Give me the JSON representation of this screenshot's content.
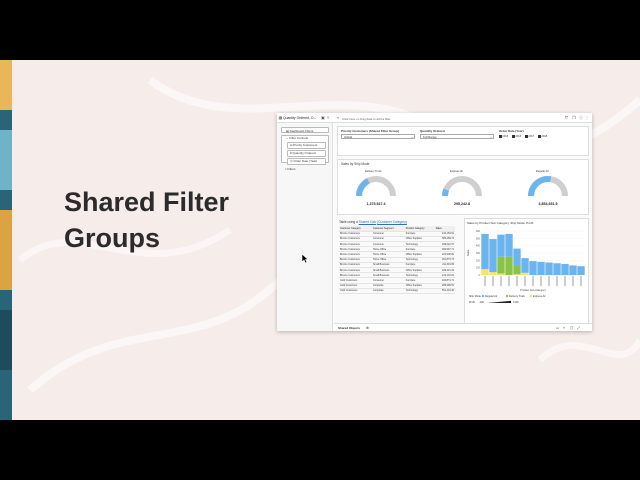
{
  "slide": {
    "headline_line1": "Shared Filter",
    "headline_line2": "Groups"
  },
  "app": {
    "title": "Quantity Ordered, O...",
    "filter_hint": "Click here or drag data to add a filter",
    "sidebar": {
      "dashboard_filters": "Dashboard Filters",
      "filter_controls": "Filter Controls",
      "items": [
        "Priority Customers",
        "Quantity Ordered",
        "Order Date (Year)"
      ],
      "filters": "Filters"
    },
    "filter_bar": {
      "priority_label": "Priority Customers (Shared Filter Group)",
      "priority_value": "Global",
      "quantity_label": "Quantity Ordered",
      "quantity_value": "Full Range",
      "year_label": "Order Date (Year)",
      "years": [
        "2015",
        "2016",
        "2017",
        "2018"
      ]
    },
    "gauges": {
      "title": "Sales by Ship Mode",
      "items": [
        {
          "label": "Delivery Truck",
          "value": "1,375,927.4",
          "fill": 0.35
        },
        {
          "label": "Express Air",
          "value": "295,242.8",
          "fill": 0.12
        },
        {
          "label": "Regular Air",
          "value": "3,854,651.9",
          "fill": 0.55
        }
      ],
      "colors": {
        "fill": "#6cb4ee",
        "track": "#cfcfcf"
      }
    },
    "table": {
      "title_prefix": "Table using a ",
      "title_link1": "Shared Calc",
      "title_mid": " ",
      "title_link2": "(Customer Category)",
      "headers": [
        "Customer Category",
        "Customer Segment",
        "Product Category",
        "Sales"
      ],
      "rows": [
        [
          "Bronze Customers",
          "Consumer",
          "Furniture",
          "244,183.91"
        ],
        [
          "Bronze Customers",
          "Consumer",
          "Office Supplies",
          "380,189.74"
        ],
        [
          "Bronze Customers",
          "Consumer",
          "Technology",
          "299,022.07"
        ],
        [
          "Bronze Customers",
          "Home Office",
          "Furniture",
          "360,997.71"
        ],
        [
          "Bronze Customers",
          "Home Office",
          "Office Supplies",
          "222,908.99"
        ],
        [
          "Bronze Customers",
          "Home Office",
          "Technology",
          "261,873.73"
        ],
        [
          "Bronze Customers",
          "Small Business",
          "Furniture",
          "211,319.05"
        ],
        [
          "Bronze Customers",
          "Small Business",
          "Office Supplies",
          "189,221.33"
        ],
        [
          "Bronze Customers",
          "Small Business",
          "Technology",
          "212,132.61"
        ],
        [
          "Gold Customers",
          "Consumer",
          "Furniture",
          "400,874.71"
        ],
        [
          "Gold Customers",
          "Corporate",
          "Office Supplies",
          "286,295.51"
        ],
        [
          "Gold Customers",
          "Corporate",
          "Technology",
          "551,419.40"
        ]
      ]
    },
    "bottom": {
      "tab": "Shared Objects"
    }
  },
  "chart_data": {
    "type": "bar",
    "title": "Sales by Product Sub Category, Ship Mode, Profit",
    "xlabel": "Product Sub Category",
    "ylabel": "Sales",
    "ylim": [
      0,
      600
    ],
    "yticks": [
      "600",
      "500",
      "400",
      "300",
      "200",
      "100",
      "0"
    ],
    "legend_title": "Ship Mode",
    "profit_label": "Profit",
    "profit_min": "-19K",
    "profit_max": "134K",
    "series": [
      {
        "name": "Regular Air",
        "color": "#6cb4ee",
        "values": [
          480,
          450,
          300,
          310,
          230,
          200,
          190,
          180,
          170,
          160,
          150,
          130,
          120
        ]
      },
      {
        "name": "Delivery Truck",
        "color": "#8bc34a",
        "values": [
          0,
          0,
          230,
          250,
          120,
          0,
          0,
          0,
          0,
          0,
          0,
          0,
          0
        ]
      },
      {
        "name": "Express Air",
        "color": "#f5e56b",
        "values": [
          80,
          40,
          20,
          0,
          10,
          30,
          0,
          0,
          0,
          0,
          0,
          0,
          0
        ]
      }
    ]
  }
}
